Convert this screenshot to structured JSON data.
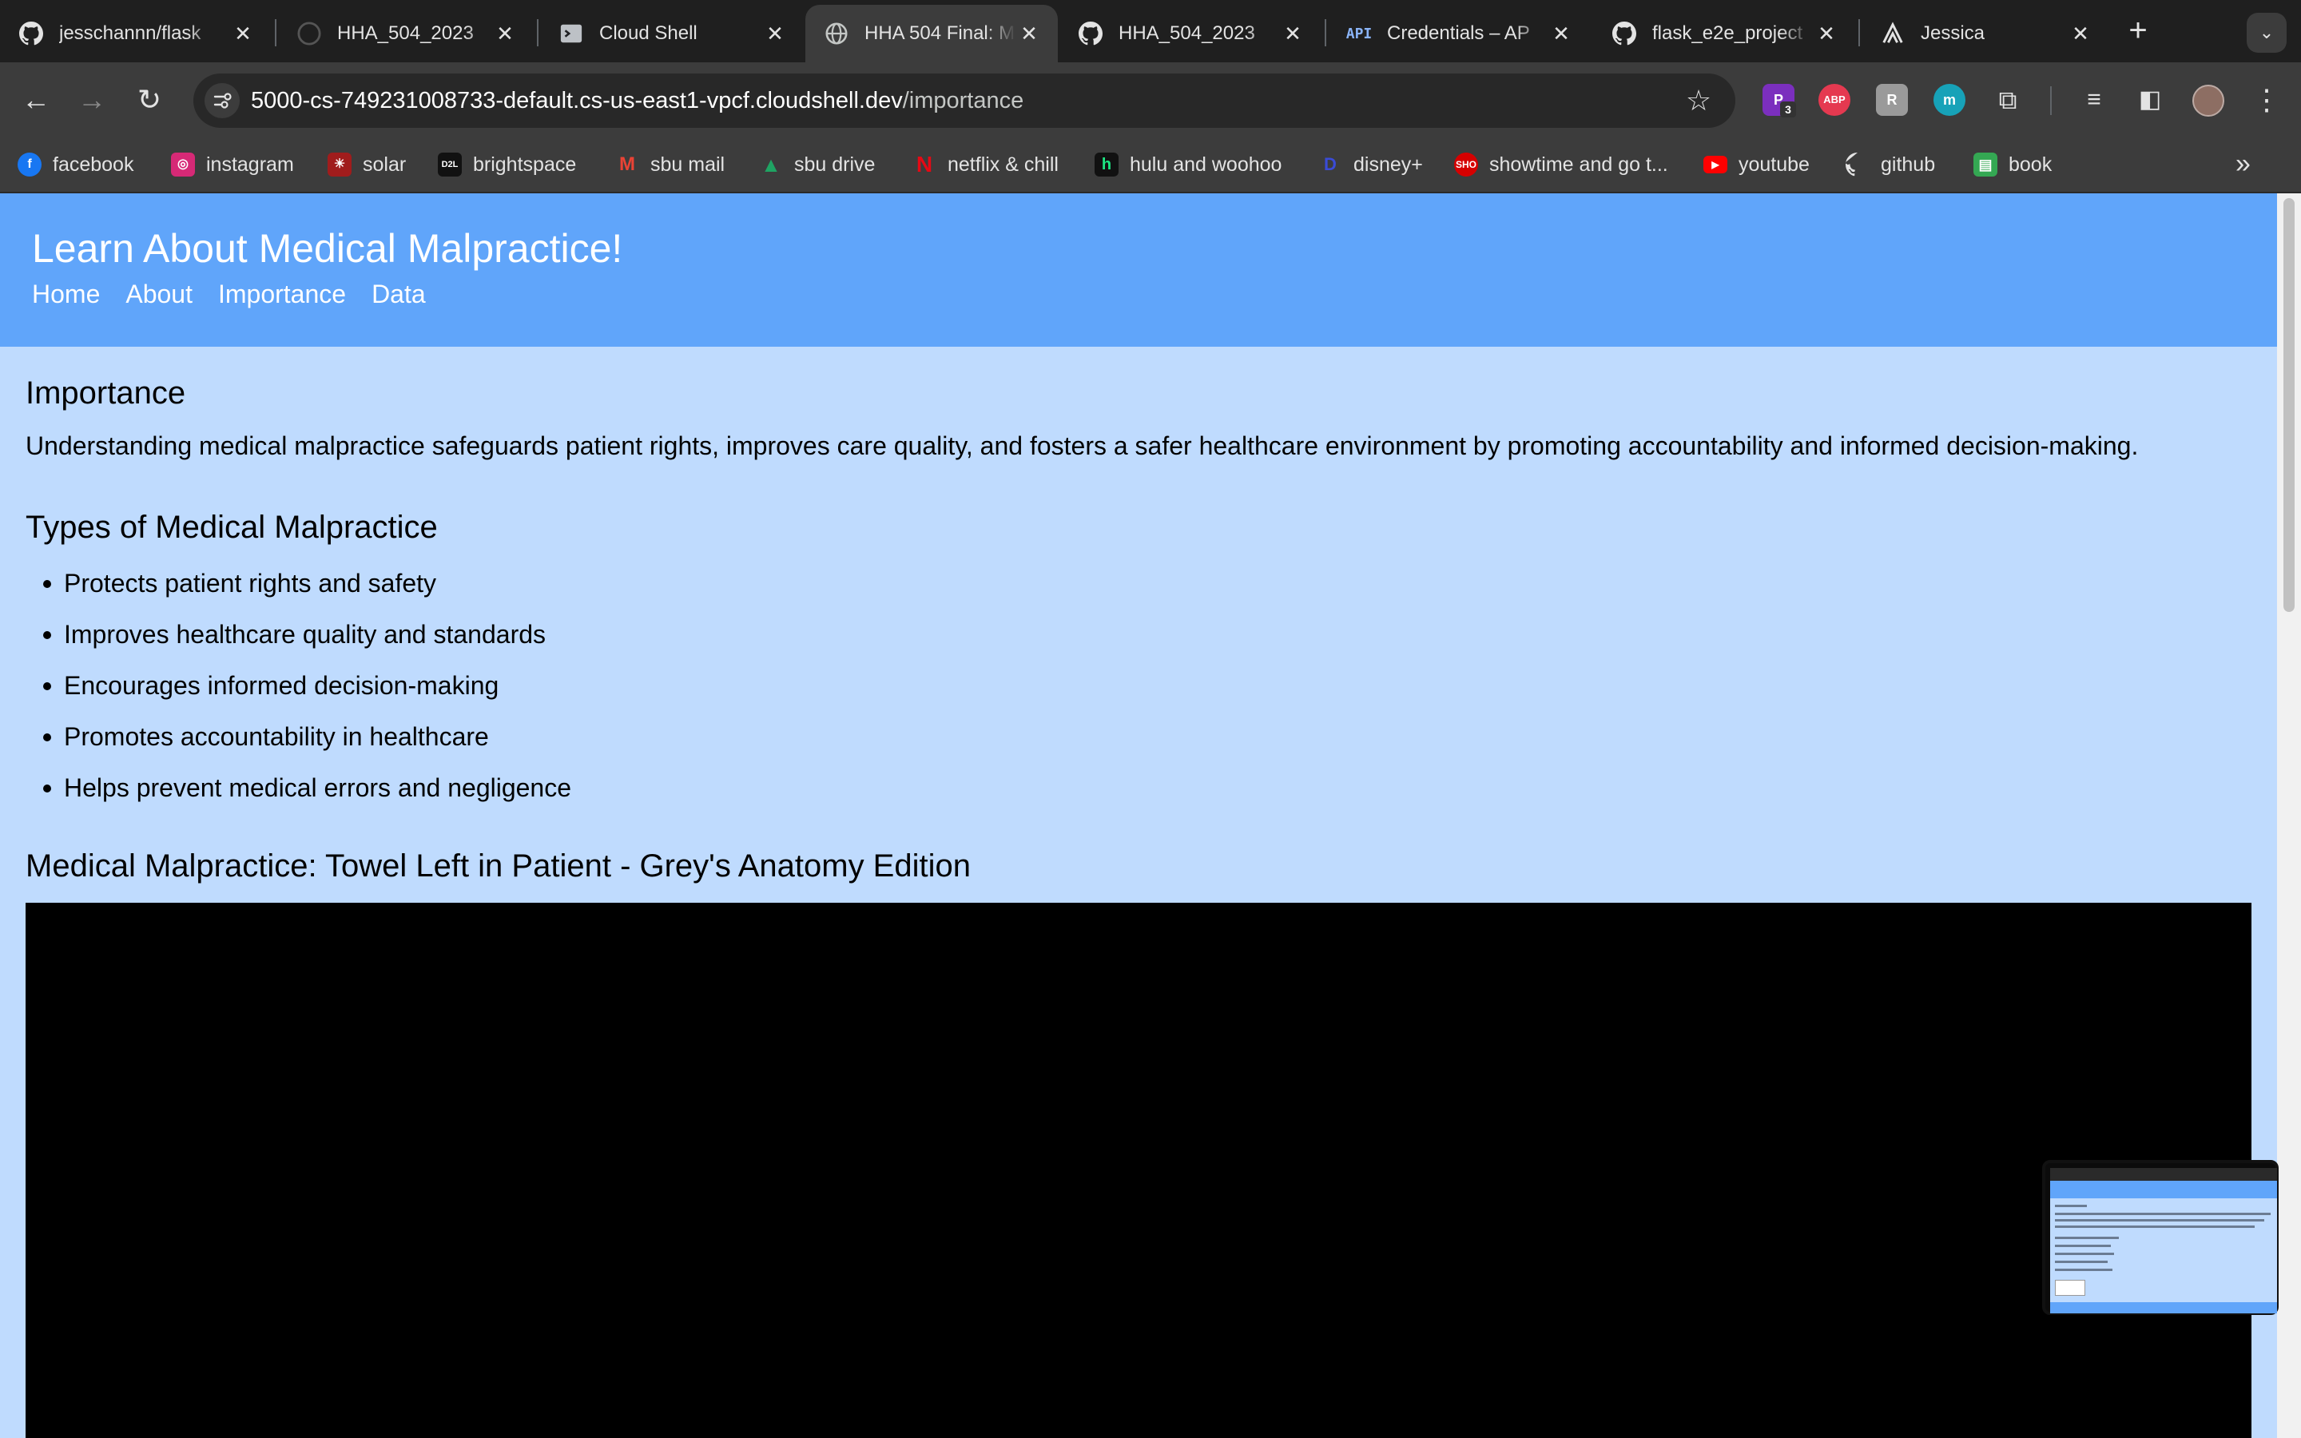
{
  "browser": {
    "tabs": [
      {
        "title": "jesschannn/flask",
        "icon": "github-icon"
      },
      {
        "title": "HHA_504_2023",
        "icon": "github-icon"
      },
      {
        "title": "Cloud Shell",
        "icon": "cloud-shell-icon"
      },
      {
        "title": "HHA 504 Final: M",
        "icon": "globe-icon"
      },
      {
        "title": "HHA_504_2023",
        "icon": "github-icon"
      },
      {
        "title": "Credentials – AP",
        "icon": "api-icon"
      },
      {
        "title": "flask_e2e_project",
        "icon": "github-icon"
      },
      {
        "title": "Jessica",
        "icon": "render-icon"
      }
    ],
    "active_tab_index": 3,
    "url_host": "5000-cs-749231008733-default.cs-us-east1-vpcf.cloudshell.dev",
    "url_path": "/importance",
    "extensions": [
      {
        "label": "P",
        "badge": "3",
        "color": "#7b2fbe"
      },
      {
        "label": "ABP",
        "color": "#e53950"
      },
      {
        "label": "R",
        "color": "#9a9a9a"
      },
      {
        "label": "m",
        "color": "#17a2b8"
      }
    ],
    "bookmarks": [
      {
        "label": "facebook",
        "icon": "facebook-icon",
        "color": "#1877f2"
      },
      {
        "label": "instagram",
        "icon": "instagram-icon",
        "color": "#d62976"
      },
      {
        "label": "solar",
        "icon": "solar-icon",
        "color": "#a01c1c"
      },
      {
        "label": "brightspace",
        "icon": "d2l-icon",
        "color": "#111111"
      },
      {
        "label": "sbu mail",
        "icon": "gmail-icon",
        "color": "#ea4335"
      },
      {
        "label": "sbu drive",
        "icon": "drive-icon",
        "color": "#1fa463"
      },
      {
        "label": "netflix & chill",
        "icon": "netflix-icon",
        "color": "#e50914"
      },
      {
        "label": "hulu and woohoo",
        "icon": "hulu-icon",
        "color": "#1ce783"
      },
      {
        "label": "disney+",
        "icon": "disney-icon",
        "color": "#1a2a9c"
      },
      {
        "label": "showtime and go t...",
        "icon": "showtime-icon",
        "color": "#d60000"
      },
      {
        "label": "youtube",
        "icon": "youtube-icon",
        "color": "#ff0000"
      },
      {
        "label": "github",
        "icon": "github-icon",
        "color": "#ffffff"
      },
      {
        "label": "book",
        "icon": "sheets-icon",
        "color": "#34a853"
      }
    ],
    "bookmarks_overflow": "»"
  },
  "site": {
    "title": "Learn About Medical Malpractice!",
    "nav": [
      "Home",
      "About",
      "Importance",
      "Data"
    ],
    "header_color": "#60a5fa",
    "background_color": "#bfdbfe"
  },
  "content": {
    "importance_heading": "Importance",
    "importance_text": "Understanding medical malpractice safeguards patient rights, improves care quality, and fosters a safer healthcare environment by promoting accountability and informed decision-making.",
    "types_heading": "Types of Medical Malpractice",
    "types": [
      "Protects patient rights and safety",
      "Improves healthcare quality and standards",
      "Encourages informed decision-making",
      "Promotes accountability in healthcare",
      "Helps prevent medical errors and negligence"
    ],
    "video_heading": "Medical Malpractice: Towel Left in Patient - Grey's Anatomy Edition"
  }
}
